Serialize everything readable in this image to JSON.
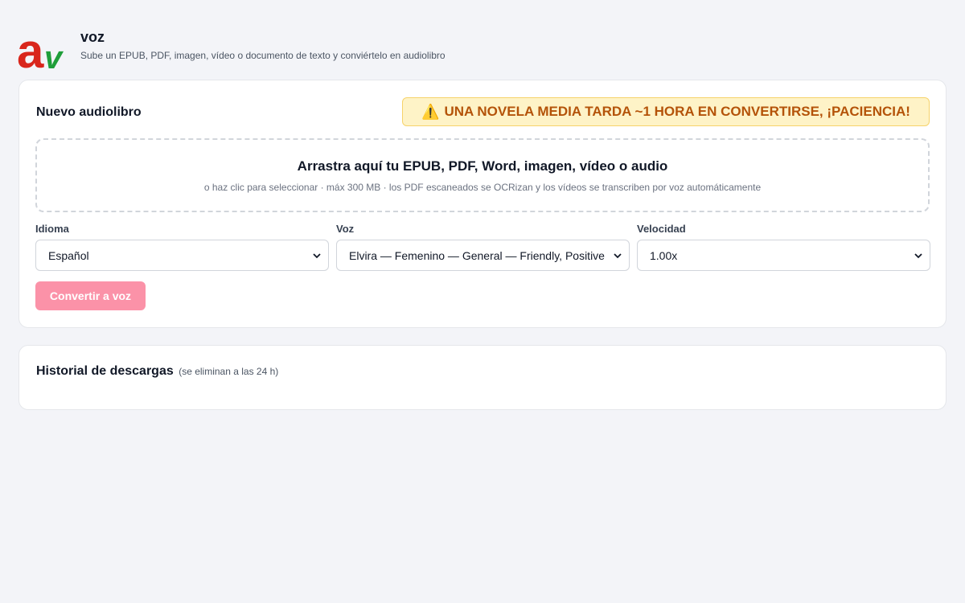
{
  "header": {
    "logo_letters": "av",
    "title": "voz",
    "subtitle": "Sube un EPUB, PDF, imagen, vídeo o documento de texto y conviértelo en audiolibro"
  },
  "new_audiobook": {
    "title": "Nuevo audiolibro",
    "warning_icon": "warning-icon",
    "warning_text": "UNA NOVELA MEDIA TARDA ~1 HORA EN CONVERTIRSE, ¡PACIENCIA!",
    "dropzone": {
      "title": "Arrastra aquí tu EPUB, PDF, Word, imagen, vídeo o audio",
      "hint": "o haz clic para seleccionar · máx 300 MB · los PDF escaneados se OCRizan y los vídeos se transcriben por voz automáticamente"
    },
    "fields": {
      "language": {
        "label": "Idioma",
        "value": "Español"
      },
      "voice": {
        "label": "Voz",
        "value": "Elvira — Femenino — General — Friendly, Positive"
      },
      "speed": {
        "label": "Velocidad",
        "value": "1.00x"
      }
    },
    "convert_label": "Convertir a voz"
  },
  "history": {
    "title": "Historial de descargas",
    "note": "(se eliminan a las 24 h)"
  },
  "colors": {
    "logo_red": "#d9261c",
    "logo_green": "#1f9e3a",
    "warning_bg": "#fef3c7",
    "warning_text": "#b45309",
    "button_disabled": "#fb92a8",
    "page_bg": "#f3f4f8"
  }
}
